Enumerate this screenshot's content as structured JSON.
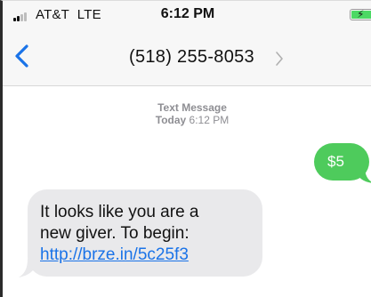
{
  "status_bar": {
    "carrier": "AT&T",
    "network": "LTE",
    "time": "6:12 PM",
    "battery": {
      "level": 1.0,
      "charging": true,
      "color": "#4cd964"
    },
    "signal_bars": 4,
    "signal_active": 2
  },
  "nav": {
    "back_icon": "chevron-left-icon",
    "contact": "(518) 255-8053",
    "details_icon": "chevron-right-icon",
    "accent_color": "#1a73e8"
  },
  "thread": {
    "label": "Text Message",
    "day": "Today",
    "time": "6:12 PM"
  },
  "messages": [
    {
      "direction": "sent",
      "text": "$5",
      "color": "#4ecb5c"
    },
    {
      "direction": "received",
      "lines": [
        "It looks like you are a",
        "new giver. To begin:"
      ],
      "link": "http://brze.in/5c25f3",
      "color": "#e9e9eb"
    }
  ]
}
